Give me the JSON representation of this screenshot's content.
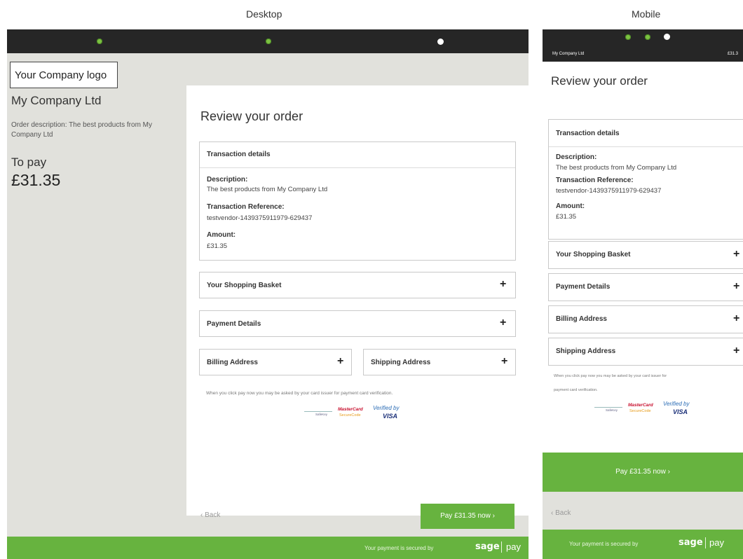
{
  "captions": {
    "desktop": "Desktop",
    "mobile": "Mobile"
  },
  "company": {
    "logo_text": "Your Company logo",
    "name": "My Company Ltd",
    "order_description": "Order description: The best products from My Company Ltd",
    "to_pay_label": "To pay",
    "to_pay_amount": "£31.35"
  },
  "progress": {
    "steps": [
      "complete",
      "complete",
      "current"
    ]
  },
  "review": {
    "title": "Review your order",
    "transaction_header": "Transaction details",
    "description_label": "Description:",
    "description_value": "The best products from My Company Ltd",
    "reference_label": "Transaction Reference:",
    "reference_value": "testvendor-1439375911979-629437",
    "amount_label": "Amount:",
    "amount_value": "£31.35",
    "sections": [
      "Your Shopping Basket",
      "Payment Details",
      "Billing Address",
      "Shipping Address"
    ],
    "expand_symbol": "+",
    "verification_note": "When you click pay now you may be asked by your card issuer for payment card verification.",
    "verification_note_mobile_1": "When you click pay now you may be asked by your card issuer for",
    "verification_note_mobile_2": "payment card verification.",
    "badges": {
      "safekey": "SafeKey",
      "mastercard": "MasterCard",
      "securecode": "SecureCode",
      "verified_by": "Verified by",
      "visa": "VISA"
    },
    "back_label": "‹ Back",
    "pay_button": "Pay £31.35 now ›"
  },
  "mobile_header": {
    "company": "My Company Ltd",
    "amount": "£31.3"
  },
  "footer": {
    "secured_text": "Your payment is secured by",
    "brand_sage": "sage",
    "brand_pay": "pay"
  },
  "colors": {
    "accent": "#67b33f",
    "bar": "#262626",
    "background": "#e1e1dc"
  }
}
